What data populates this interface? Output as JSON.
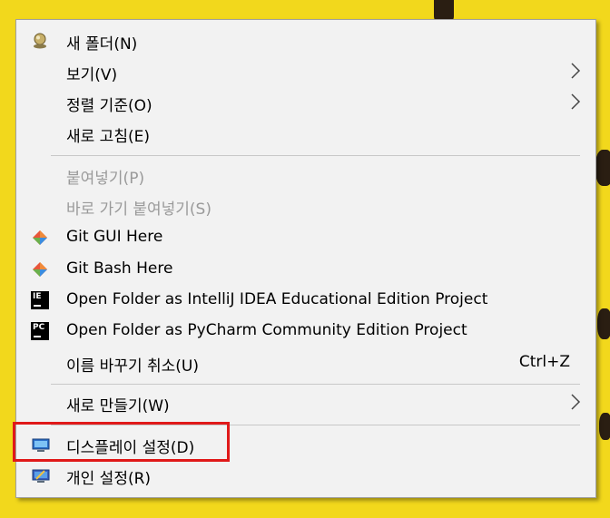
{
  "colors": {
    "desktop_bg": "#f2d81c",
    "menu_bg": "#f2f2f2",
    "highlight": "#e01919",
    "disabled_text": "#9a9a9a"
  },
  "menu": {
    "items": [
      {
        "label": "새 폴더(N)",
        "icon": "folder-icon"
      },
      {
        "label": "보기(V)",
        "submenu": true
      },
      {
        "label": "정렬 기준(O)",
        "submenu": true
      },
      {
        "label": "새로 고침(E)"
      },
      {
        "label": "붙여넣기(P)",
        "disabled": true
      },
      {
        "label": "바로 가기 붙여넣기(S)",
        "disabled": true
      },
      {
        "label": "Git GUI Here",
        "icon": "git-icon"
      },
      {
        "label": "Git Bash Here",
        "icon": "git-icon"
      },
      {
        "label": "Open Folder as IntelliJ IDEA Educational Edition Project",
        "icon": "intellij-icon"
      },
      {
        "label": "Open Folder as PyCharm Community Edition Project",
        "icon": "pycharm-icon"
      },
      {
        "label": "이름 바꾸기 취소(U)",
        "accelerator": "Ctrl+Z"
      },
      {
        "label": "새로 만들기(W)",
        "submenu": true
      },
      {
        "label": "디스플레이 설정(D)",
        "icon": "display-icon",
        "highlighted": true
      },
      {
        "label": "개인 설정(R)",
        "icon": "personalize-icon"
      }
    ],
    "intellij_icon_text": "IE",
    "pycharm_icon_text": "PC"
  }
}
